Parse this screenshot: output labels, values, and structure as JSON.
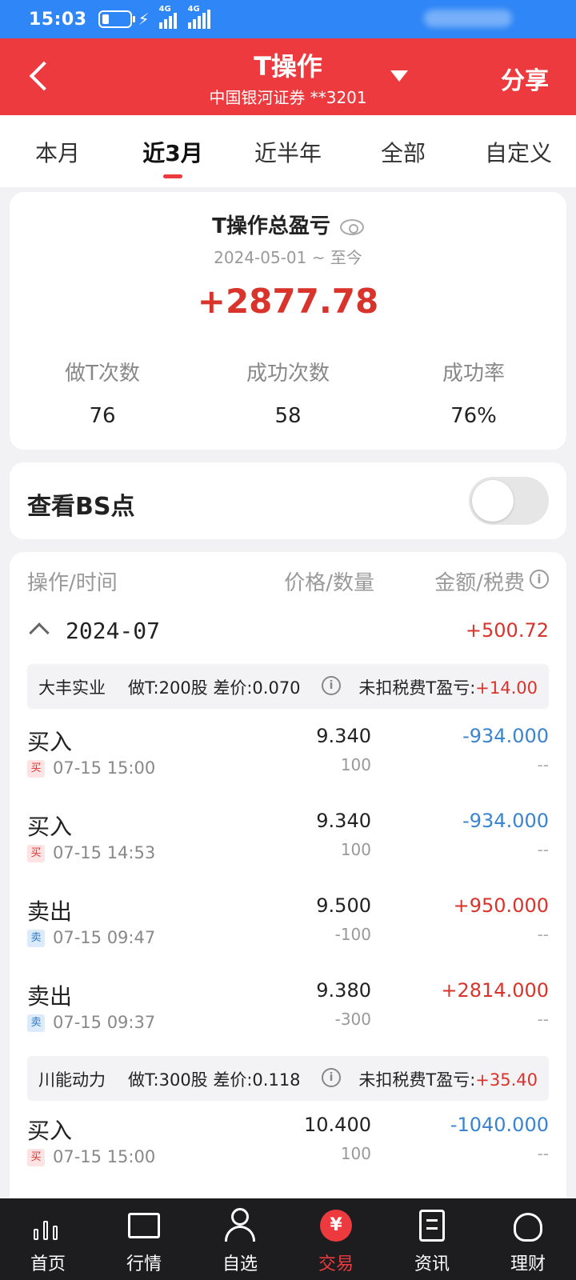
{
  "status_bar": {
    "time": "15:03",
    "network_1": "4G",
    "network_2": "4G"
  },
  "header": {
    "title": "T操作",
    "subtitle": "中国银河证券 **3201",
    "share_label": "分享"
  },
  "tabs": [
    {
      "label": "本月",
      "active": false
    },
    {
      "label": "近3月",
      "active": true
    },
    {
      "label": "近半年",
      "active": false
    },
    {
      "label": "全部",
      "active": false
    },
    {
      "label": "自定义",
      "active": false
    }
  ],
  "summary": {
    "title": "T操作总盈亏",
    "period": "2024-05-01 ~ 至今",
    "total": "+2877.78",
    "stats": [
      {
        "label": "做T次数",
        "value": "76"
      },
      {
        "label": "成功次数",
        "value": "58"
      },
      {
        "label": "成功率",
        "value": "76%"
      }
    ]
  },
  "bs_toggle": {
    "label": "查看BS点",
    "on": false
  },
  "records": {
    "columns": [
      "操作/时间",
      "价格/数量",
      "金额/税费"
    ],
    "info_glyph": "i",
    "month": {
      "label": "2024-07",
      "total": "+500.72"
    },
    "groups": [
      {
        "name": "大丰实业",
        "detail": "做T:200股 差价:0.070",
        "profit_label": "未扣税费T盈亏:",
        "profit_value": "+14.00",
        "trades": [
          {
            "type": "买入",
            "badge": "买",
            "side": "buy",
            "time": "07-15 15:00",
            "price": "9.340",
            "qty": "100",
            "amount": "-934.000",
            "fee": "--"
          },
          {
            "type": "买入",
            "badge": "买",
            "side": "buy",
            "time": "07-15 14:53",
            "price": "9.340",
            "qty": "100",
            "amount": "-934.000",
            "fee": "--"
          },
          {
            "type": "卖出",
            "badge": "卖",
            "side": "sell",
            "time": "07-15 09:47",
            "price": "9.500",
            "qty": "-100",
            "amount": "+950.000",
            "fee": "--"
          },
          {
            "type": "卖出",
            "badge": "卖",
            "side": "sell",
            "time": "07-15 09:37",
            "price": "9.380",
            "qty": "-300",
            "amount": "+2814.000",
            "fee": "--"
          }
        ]
      },
      {
        "name": "川能动力",
        "detail": "做T:300股 差价:0.118",
        "profit_label": "未扣税费T盈亏:",
        "profit_value": "+35.40",
        "trades": [
          {
            "type": "买入",
            "badge": "买",
            "side": "buy",
            "time": "07-15 15:00",
            "price": "10.400",
            "qty": "100",
            "amount": "-1040.000",
            "fee": "--"
          }
        ]
      }
    ]
  },
  "bottom_nav": [
    {
      "label": "首页",
      "icon": "candlestick-icon",
      "active": false
    },
    {
      "label": "行情",
      "icon": "line-chart-icon",
      "active": false
    },
    {
      "label": "自选",
      "icon": "user-icon",
      "active": false
    },
    {
      "label": "交易",
      "icon": "yen-icon",
      "active": true,
      "glyph": "¥"
    },
    {
      "label": "资讯",
      "icon": "document-icon",
      "active": false
    },
    {
      "label": "理财",
      "icon": "money-bag-icon",
      "active": false
    }
  ],
  "colors": {
    "brand_red": "#ec3a3f",
    "status_blue": "#2f86f6",
    "profit_red": "#d9342c",
    "loss_blue": "#3a84d0"
  }
}
